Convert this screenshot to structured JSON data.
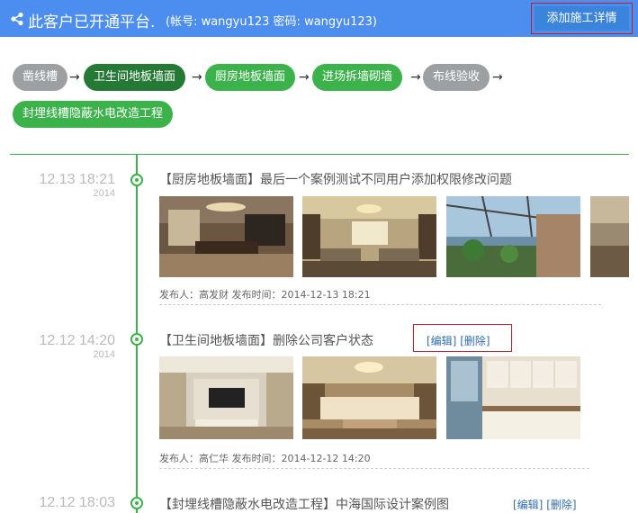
{
  "header": {
    "title": "此客户已开通平台.",
    "account_info": "(帐号: wangyu123   密码: wangyu123)",
    "add_button": "添加施工详情"
  },
  "steps": [
    {
      "label": "凿线槽",
      "state": "gray"
    },
    {
      "label": "卫生间地板墙面",
      "state": "dark"
    },
    {
      "label": "厨房地板墙面",
      "state": "green"
    },
    {
      "label": "进场拆墙砌墙",
      "state": "green"
    },
    {
      "label": "布线验收",
      "state": "gray"
    },
    {
      "label": "封埋线槽隐蔽水电改造工程",
      "state": "green"
    }
  ],
  "arrow": "→",
  "entries": [
    {
      "time": "12.13 18:21",
      "year": "2014",
      "title": "【厨房地板墙面】最后一个案例测试不同用户添加权限修改问题",
      "meta": "发布人：高发财    发布时间：2014-12-13 18:21",
      "photos": [
        "dining-room-photo",
        "living-room-photo",
        "sunroom-photo",
        "room-photo-partial"
      ]
    },
    {
      "time": "12.12 14:20",
      "year": "2014",
      "title": "【卫生间地板墙面】删除公司客户状态",
      "edit": "[编辑]",
      "delete": "[删除]",
      "meta": "发布人：高仁华    发布时间：2014-12-12 14:20",
      "photos": [
        "tv-wall-photo",
        "sofa-room-photo",
        "kitchen-photo"
      ]
    },
    {
      "time": "12.12 18:03",
      "year": "",
      "title": "【封埋线槽隐蔽水电改造工程】中海国际设计案例图",
      "edit": "[编辑]",
      "delete": "[删除]"
    }
  ],
  "colors": {
    "accent": "#4c8ef0",
    "green": "#3bb34a",
    "dark_green": "#247a34",
    "gray": "#9da0a3",
    "highlight": "#c0202a"
  }
}
